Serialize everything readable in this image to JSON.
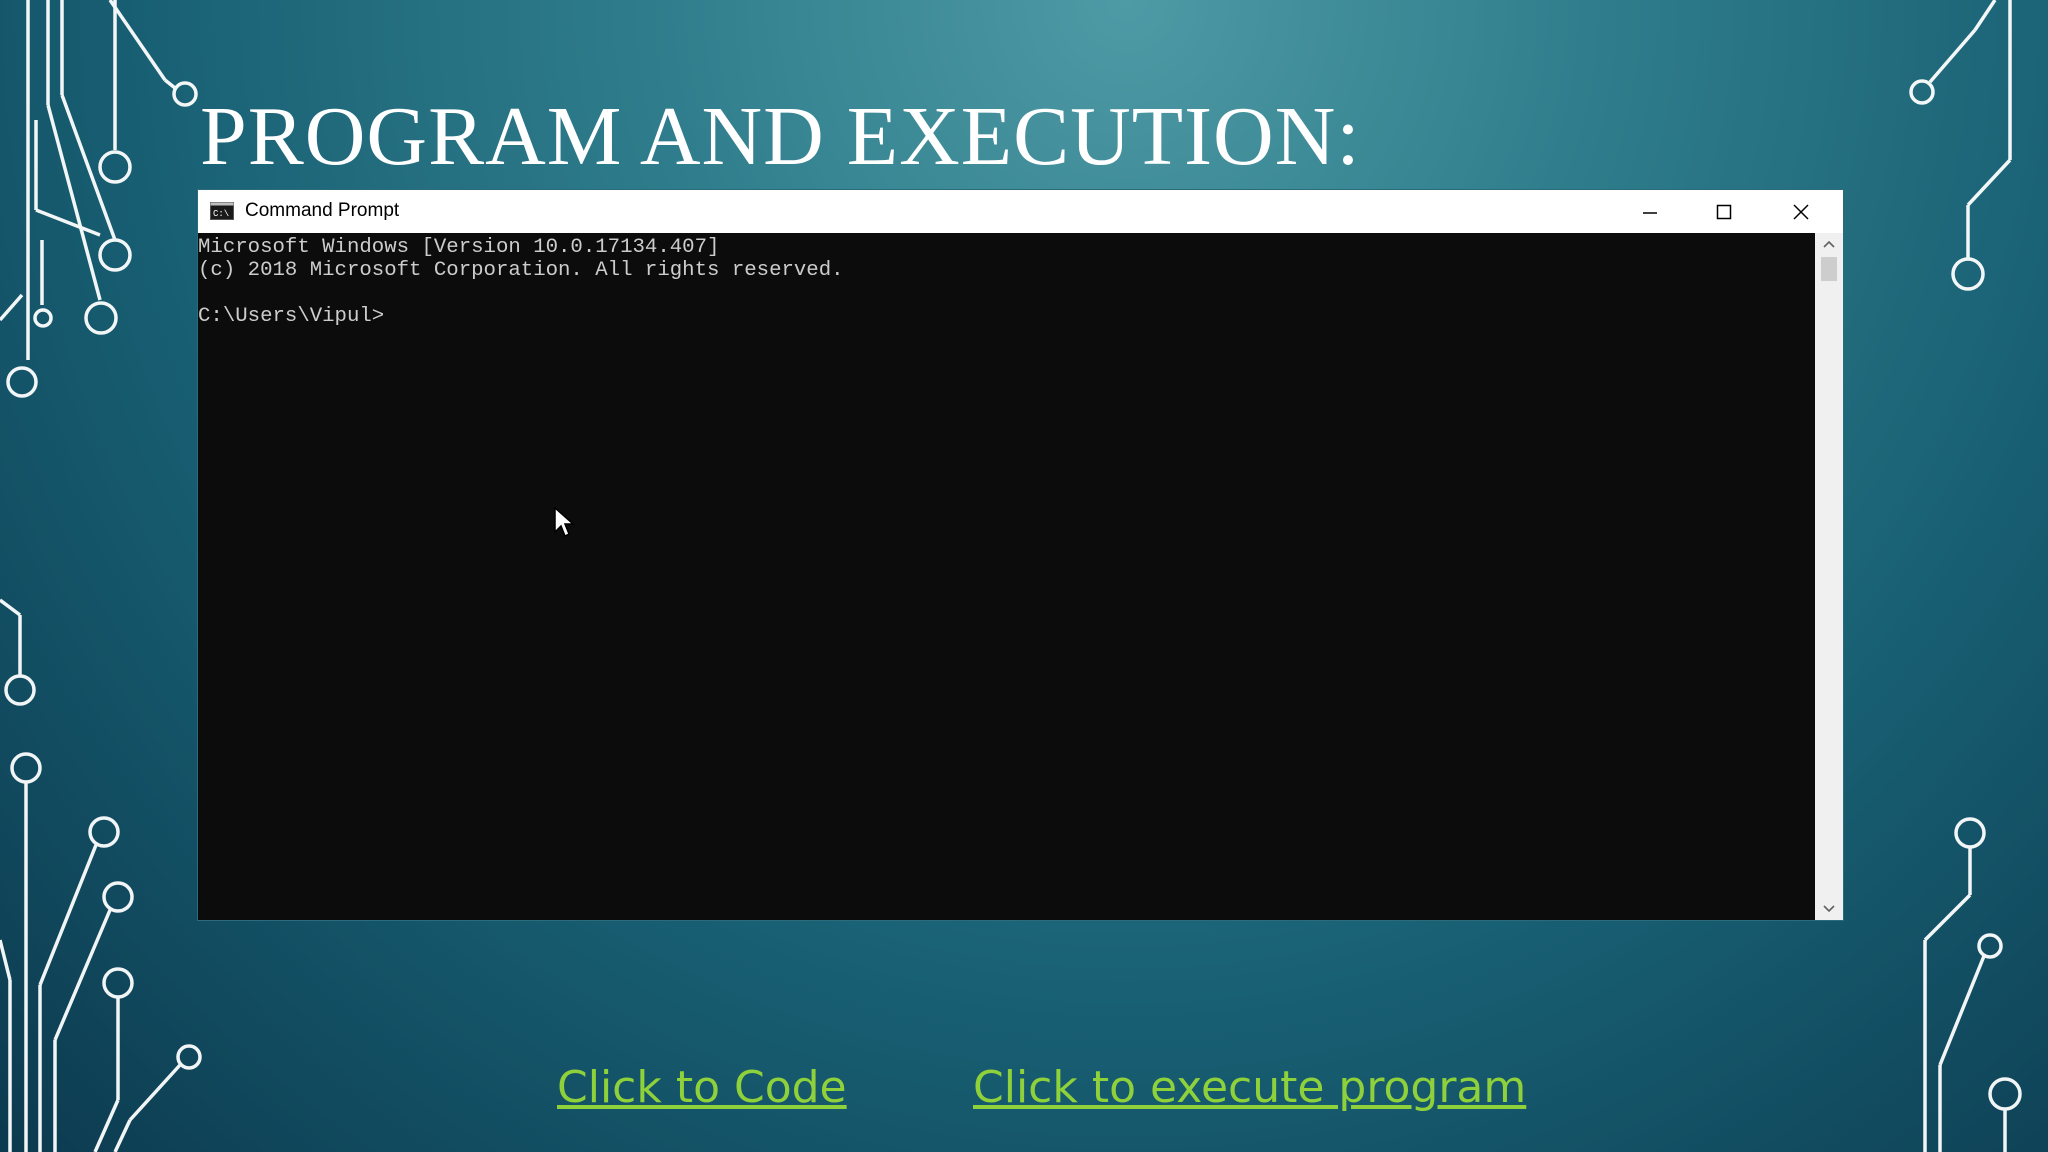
{
  "slide": {
    "title": "PROGRAM AND EXECUTION:"
  },
  "window": {
    "title": "Command Prompt",
    "icon": "cmd-icon",
    "controls": [
      "minimize-icon",
      "maximize-icon",
      "close-icon"
    ]
  },
  "console": {
    "lines": [
      "Microsoft Windows [Version 10.0.17134.407]",
      "(c) 2018 Microsoft Corporation. All rights reserved.",
      "",
      "C:\\Users\\Vipul>"
    ]
  },
  "links": {
    "code": "Click to Code",
    "execute": "Click to execute program"
  },
  "colors": {
    "background_light": "#4e9aa5",
    "background_dark": "#0c3a4f",
    "circuit": "#ffffff",
    "link": "#8fd13a",
    "console_bg": "#0c0c0c",
    "console_text": "#cccccc"
  }
}
